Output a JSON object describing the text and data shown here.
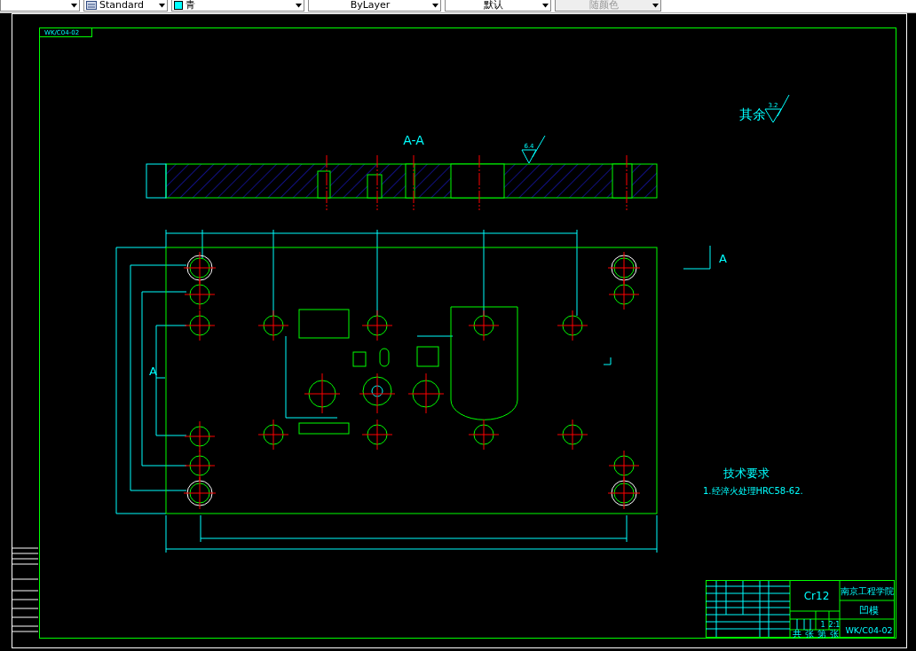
{
  "toolbar": {
    "dropdowns": [
      {
        "kind": "icon",
        "value": "Standard",
        "disabled": false
      },
      {
        "kind": "color",
        "value": "青",
        "color": "#00ffff",
        "disabled": false
      },
      {
        "kind": "plain",
        "value": "ByLayer",
        "disabled": false
      },
      {
        "kind": "plain",
        "value": "默认",
        "disabled": false
      },
      {
        "kind": "plain",
        "value": "随颜色",
        "disabled": true
      }
    ]
  },
  "drawing": {
    "sheet_code": "WK/C04-02",
    "section_label": "A-A",
    "section_roughness": "6.4",
    "view_marks": [
      "A",
      "A"
    ],
    "general_roughness": {
      "label": "其余",
      "value": "3.2"
    },
    "technical_requirements": {
      "title": "技术要求",
      "items": [
        "1.经淬火处理HRC58-62."
      ]
    },
    "title_block": {
      "material": "Cr12",
      "school": "南京工程学院",
      "part_name": "凹模",
      "drawing_number": "WK/C04-02",
      "quantity": "1",
      "scale": "2:1",
      "sheet_total": "共 张",
      "sheet_number": "第 张"
    }
  }
}
